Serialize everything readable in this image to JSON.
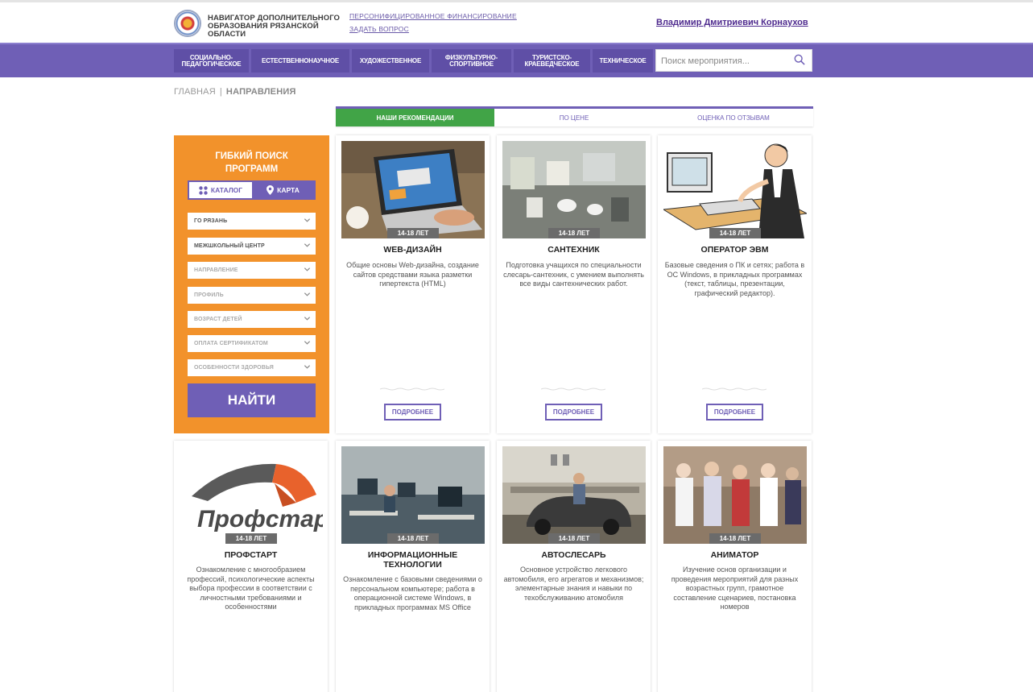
{
  "header": {
    "logo_text": "НАВИГАТОР ДОПОЛНИТЕЛЬНОГО ОБРАЗОВАНИЯ РЯЗАНСКОЙ ОБЛАСТИ",
    "link_financing": "ПЕРСОНИФИЦИРОВАННОЕ ФИНАНСИРОВАНИЕ",
    "link_ask": "ЗАДАТЬ ВОПРОС",
    "user_name": "Владимир Дмитриевич Корнаухов"
  },
  "nav": {
    "items": [
      {
        "label": "СОЦИАЛЬНО-ПЕДАГОГИЧЕСКОЕ"
      },
      {
        "label": "ЕСТЕСТВЕННОНАУЧНОЕ"
      },
      {
        "label": "ХУДОЖЕСТВЕННОЕ"
      },
      {
        "label": "ФИЗКУЛЬТУРНО-СПОРТИВНОЕ"
      },
      {
        "label": "ТУРИСТСКО-КРАЕВЕДЧЕСКОЕ"
      },
      {
        "label": "ТЕХНИЧЕСКОЕ"
      }
    ],
    "search_placeholder": "Поиск мероприятия..."
  },
  "breadcrumb": {
    "home": "ГЛАВНАЯ",
    "separator": "|",
    "current": "НАПРАВЛЕНИЯ"
  },
  "sort_tabs": [
    {
      "label": "НАШИ РЕКОМЕНДАЦИИ",
      "active": true
    },
    {
      "label": "ПО ЦЕНЕ",
      "active": false
    },
    {
      "label": "ОЦЕНКА ПО ОТЗЫВАМ",
      "active": false
    }
  ],
  "filter": {
    "title_line1": "ГИБКИЙ ПОИСК",
    "title_line2": "ПРОГРАММ",
    "view_catalog": "КАТАЛОГ",
    "view_map": "КАРТА",
    "selects": [
      {
        "value": "ГО РЯЗАНЬ"
      },
      {
        "value": "МЕЖШКОЛЬНЫЙ ЦЕНТР"
      },
      {
        "value": "НАПРАВЛЕНИЕ"
      },
      {
        "value": "ПРОФИЛЬ"
      },
      {
        "value": "ВОЗРАСТ ДЕТЕЙ"
      },
      {
        "value": "ОПЛАТА СЕРТИФИКАТОМ"
      },
      {
        "value": "ОСОБЕННОСТИ ЗДОРОВЬЯ"
      }
    ],
    "find_label": "НАЙТИ"
  },
  "cards": [
    {
      "age": "14-18 ЛЕТ",
      "title": "WEB-ДИЗАЙН",
      "description": "Общие основы Web-дизайна, создание сайтов средствами языка разметки гипертекста (HTML)",
      "more": "ПОДРОБНЕЕ"
    },
    {
      "age": "14-18 ЛЕТ",
      "title": "САНТЕХНИК",
      "description": "Подготовка учащихся по специальности слесарь-сантехник, с умением выполнять все виды сантехнических работ.",
      "more": "ПОДРОБНЕЕ"
    },
    {
      "age": "14-18 ЛЕТ",
      "title": "ОПЕРАТОР ЭВМ",
      "description": "Базовые сведения о ПК и сетях; работа в ОС Windows, в прикладных программах (текст, таблицы, презентации, графический редактор).",
      "more": "ПОДРОБНЕЕ"
    },
    {
      "age": "14-18 ЛЕТ",
      "title": "ПРОФСТАРТ",
      "logo_text": "Профстарт",
      "description": "Ознакомление с многообразием профессий, психологические аспекты выбора профессии в соответствии с личностными требованиями и особенностями"
    },
    {
      "age": "14-18 ЛЕТ",
      "title": "ИНФОРМАЦИОННЫЕ ТЕХНОЛОГИИ",
      "description": "Ознакомление с базовыми сведениями о персональном компьютере; работа в операционной системе Windows, в прикладных программах MS Office"
    },
    {
      "age": "14-18 ЛЕТ",
      "title": "АВТОСЛЕСАРЬ",
      "description": "Основное устройство легкового автомобиля, его агрегатов и механизмов; элементарные знания и навыки по техобслуживанию атомобиля"
    },
    {
      "age": "14-18 ЛЕТ",
      "title": "АНИМАТОР",
      "description": "Изучение основ организации и проведения мероприятий для разных возрастных групп, грамотное составление сценариев, постановка номеров"
    }
  ],
  "colors": {
    "purple": "#6f5fb6",
    "orange": "#f2922b",
    "green": "#41a447",
    "badge_gray": "#6b6b6b"
  }
}
